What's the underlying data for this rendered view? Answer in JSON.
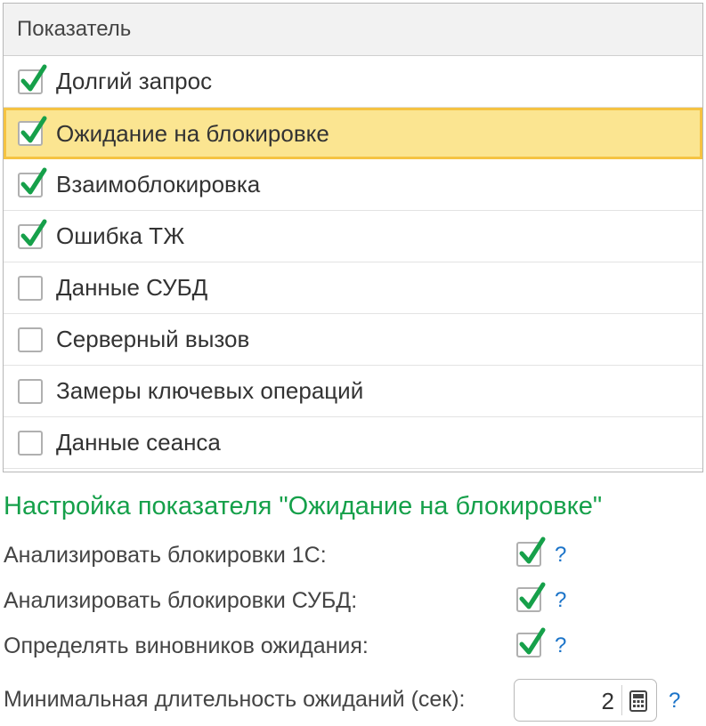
{
  "table": {
    "header": "Показатель",
    "rows": [
      {
        "label": "Долгий запрос",
        "checked": true
      },
      {
        "label": "Ожидание на блокировке",
        "checked": true,
        "selected": true
      },
      {
        "label": "Взаимоблокировка",
        "checked": true
      },
      {
        "label": "Ошибка ТЖ",
        "checked": true
      },
      {
        "label": "Данные СУБД",
        "checked": false
      },
      {
        "label": "Серверный вызов",
        "checked": false
      },
      {
        "label": "Замеры ключевых операций",
        "checked": false
      },
      {
        "label": "Данные сеанса",
        "checked": false
      }
    ]
  },
  "settings": {
    "title": "Настройка показателя \"Ожидание на блокировке\"",
    "analyze_1c_label": "Анализировать блокировки 1С:",
    "analyze_dbms_label": "Анализировать блокировки СУБД:",
    "find_culprits_label": "Определять виновников ожидания:",
    "min_duration_label": "Минимальная длительность ожиданий (сек):",
    "min_duration_value": "2",
    "help": "?"
  },
  "colors": {
    "check": "#16a04a",
    "selected_bg": "#fbe591",
    "selected_border": "#f5c342",
    "title": "#15a04a",
    "help": "#1a73c8"
  }
}
